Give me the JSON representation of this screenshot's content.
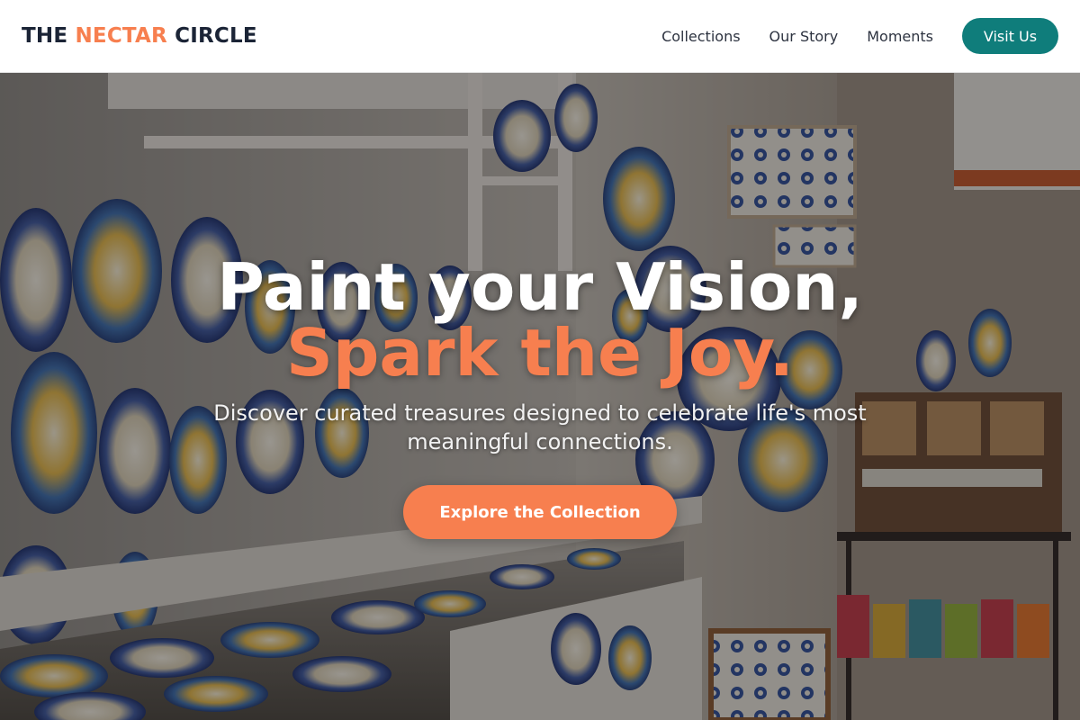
{
  "header": {
    "logo_prefix": "THE",
    "logo_accent": "NECTAR",
    "logo_suffix": "CIRCLE",
    "nav": [
      {
        "label": "Collections"
      },
      {
        "label": "Our Story"
      },
      {
        "label": "Moments"
      }
    ],
    "visit_label": "Visit Us"
  },
  "hero": {
    "headline_line1": "Paint your Vision,",
    "headline_line2": "Spark the Joy.",
    "subtext": "Discover curated treasures designed to celebrate life's most meaningful connections.",
    "cta_label": "Explore the Collection",
    "background_image": "ceramics-shop-photo"
  },
  "colors": {
    "brand_dark": "#1b2436",
    "accent_orange": "#f77f4f",
    "teal_button": "#0f7d7b",
    "header_bg": "#ffffff"
  }
}
